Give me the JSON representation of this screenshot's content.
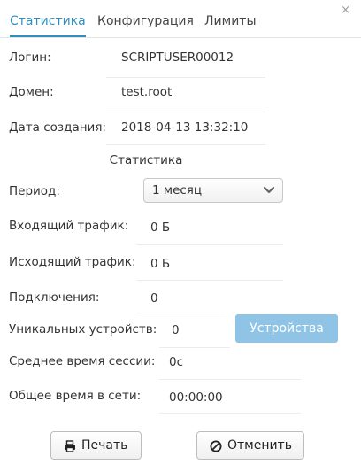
{
  "window": {
    "close_glyph": "×"
  },
  "tabs": [
    {
      "label": "Статистика",
      "active": true
    },
    {
      "label": "Конфигурация",
      "active": false
    },
    {
      "label": "Лимиты",
      "active": false
    }
  ],
  "info": {
    "login_label": "Логин:",
    "login_value": "SCRIPTUSER00012",
    "domain_label": "Домен:",
    "domain_value": "test.root",
    "created_label": "Дата создания:",
    "created_value": "2018-04-13 13:32:10"
  },
  "stats": {
    "section_title": "Статистика",
    "period_label": "Период:",
    "period_selected": "1 месяц",
    "incoming_label": "Входящий трафик:",
    "incoming_value": "0 Б",
    "outgoing_label": "Исходящий трафик:",
    "outgoing_value": "0 Б",
    "connections_label": "Подключения:",
    "connections_value": "0",
    "unique_devices_label": "Уникальных устройств:",
    "unique_devices_value": "0",
    "devices_button": "Устройства",
    "avg_session_label": "Среднее время сессии:",
    "avg_session_value": "0с",
    "total_time_label": "Общее время в сети:",
    "total_time_value": "00:00:00"
  },
  "footer": {
    "print_button": "Печать",
    "cancel_button": "Отменить"
  },
  "colors": {
    "accent": "#2c8fc0",
    "devices_button_bg": "#8fc4e6"
  },
  "icons": {
    "close": "close-icon",
    "select_arrow": "chevron-down-icon",
    "print": "printer-icon",
    "cancel": "ban-icon"
  }
}
